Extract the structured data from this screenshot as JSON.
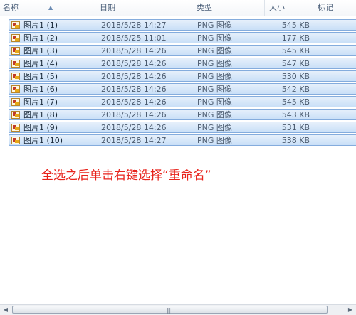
{
  "columns": {
    "name": "名称",
    "date": "日期",
    "type": "类型",
    "size": "大小",
    "tags": "标记"
  },
  "files": [
    {
      "name": "图片1 (1)",
      "date": "2018/5/28 14:27",
      "type": "PNG 图像",
      "size": "545 KB"
    },
    {
      "name": "图片1 (2)",
      "date": "2018/5/25 11:01",
      "type": "PNG 图像",
      "size": "177 KB"
    },
    {
      "name": "图片1 (3)",
      "date": "2018/5/28 14:26",
      "type": "PNG 图像",
      "size": "545 KB"
    },
    {
      "name": "图片1 (4)",
      "date": "2018/5/28 14:26",
      "type": "PNG 图像",
      "size": "547 KB"
    },
    {
      "name": "图片1 (5)",
      "date": "2018/5/28 14:26",
      "type": "PNG 图像",
      "size": "530 KB"
    },
    {
      "name": "图片1 (6)",
      "date": "2018/5/28 14:26",
      "type": "PNG 图像",
      "size": "542 KB"
    },
    {
      "name": "图片1 (7)",
      "date": "2018/5/28 14:26",
      "type": "PNG 图像",
      "size": "545 KB"
    },
    {
      "name": "图片1 (8)",
      "date": "2018/5/28 14:26",
      "type": "PNG 图像",
      "size": "543 KB"
    },
    {
      "name": "图片1 (9)",
      "date": "2018/5/28 14:26",
      "type": "PNG 图像",
      "size": "531 KB"
    },
    {
      "name": "图片1 (10)",
      "date": "2018/5/28 14:27",
      "type": "PNG 图像",
      "size": "538 KB"
    }
  ],
  "annotation": "全选之后单击右键选择“重命名”",
  "colors": {
    "selection": "#c9dff7",
    "selection_border": "#84acdd",
    "annotation": "#e8231c"
  }
}
